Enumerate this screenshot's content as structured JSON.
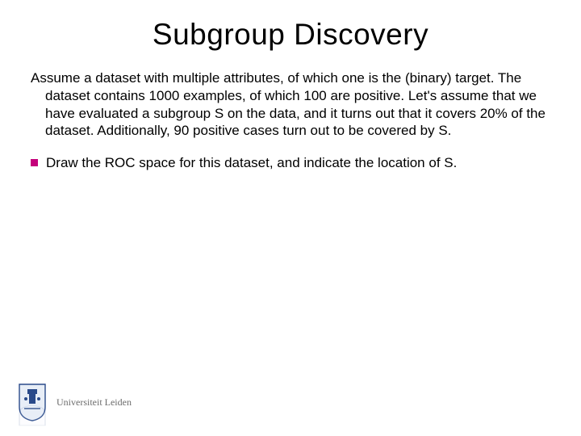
{
  "title": "Subgroup Discovery",
  "paragraph": "Assume a dataset with multiple attributes, of which one is the (binary) target. The dataset contains 1000 examples, of which 100 are positive. Let's assume that we have evaluated a subgroup S on the data, and it turns out that it covers 20% of the dataset. Additionally, 90 positive cases turn out to be covered by S.",
  "bullet1": "Draw the ROC space for this dataset, and indicate the location of S.",
  "university": "Universiteit Leiden"
}
